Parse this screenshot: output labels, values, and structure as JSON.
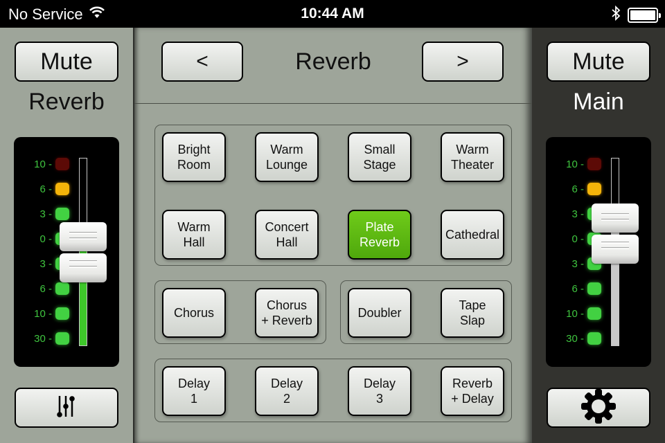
{
  "status_bar": {
    "carrier": "No Service",
    "time": "10:44 AM",
    "battery_level": 1.0
  },
  "left_channel": {
    "mute_label": "Mute",
    "name": "Reverb",
    "meter_labels": [
      "10",
      "6",
      "3",
      "0",
      "3",
      "6",
      "10",
      "30"
    ],
    "led_colors": [
      "red",
      "amber",
      "green",
      "green",
      "green",
      "green",
      "green",
      "green"
    ],
    "fader_level": 0.5,
    "bottom_button": "mixer-sliders"
  },
  "center": {
    "prev_label": "<",
    "next_label": ">",
    "title": "Reverb",
    "active_preset": "Plate Reverb",
    "groups": [
      {
        "presets": [
          [
            "Bright",
            "Room"
          ],
          [
            "Warm",
            "Lounge"
          ],
          [
            "Small",
            "Stage"
          ],
          [
            "Warm",
            "Theater"
          ],
          [
            "Warm",
            "Hall"
          ],
          [
            "Concert",
            "Hall"
          ],
          [
            "Plate",
            "Reverb"
          ],
          [
            "Cathedral",
            ""
          ]
        ]
      },
      {
        "presets": [
          [
            "Chorus",
            ""
          ],
          [
            "Chorus",
            "+ Reverb"
          ]
        ]
      },
      {
        "presets": [
          [
            "Doubler",
            ""
          ],
          [
            "Tape",
            "Slap"
          ]
        ]
      },
      {
        "presets": [
          [
            "Delay",
            "1"
          ],
          [
            "Delay",
            "2"
          ],
          [
            "Delay",
            "3"
          ],
          [
            "Reverb",
            "+ Delay"
          ]
        ]
      }
    ],
    "accent_color": "#5cb812"
  },
  "right_channel": {
    "mute_label": "Mute",
    "name": "Main",
    "meter_labels": [
      "10",
      "6",
      "3",
      "0",
      "3",
      "6",
      "10",
      "30"
    ],
    "led_colors": [
      "red",
      "amber",
      "green",
      "green",
      "green",
      "green",
      "green",
      "green"
    ],
    "fader_level": 0.6,
    "bottom_button": "settings-gear"
  }
}
